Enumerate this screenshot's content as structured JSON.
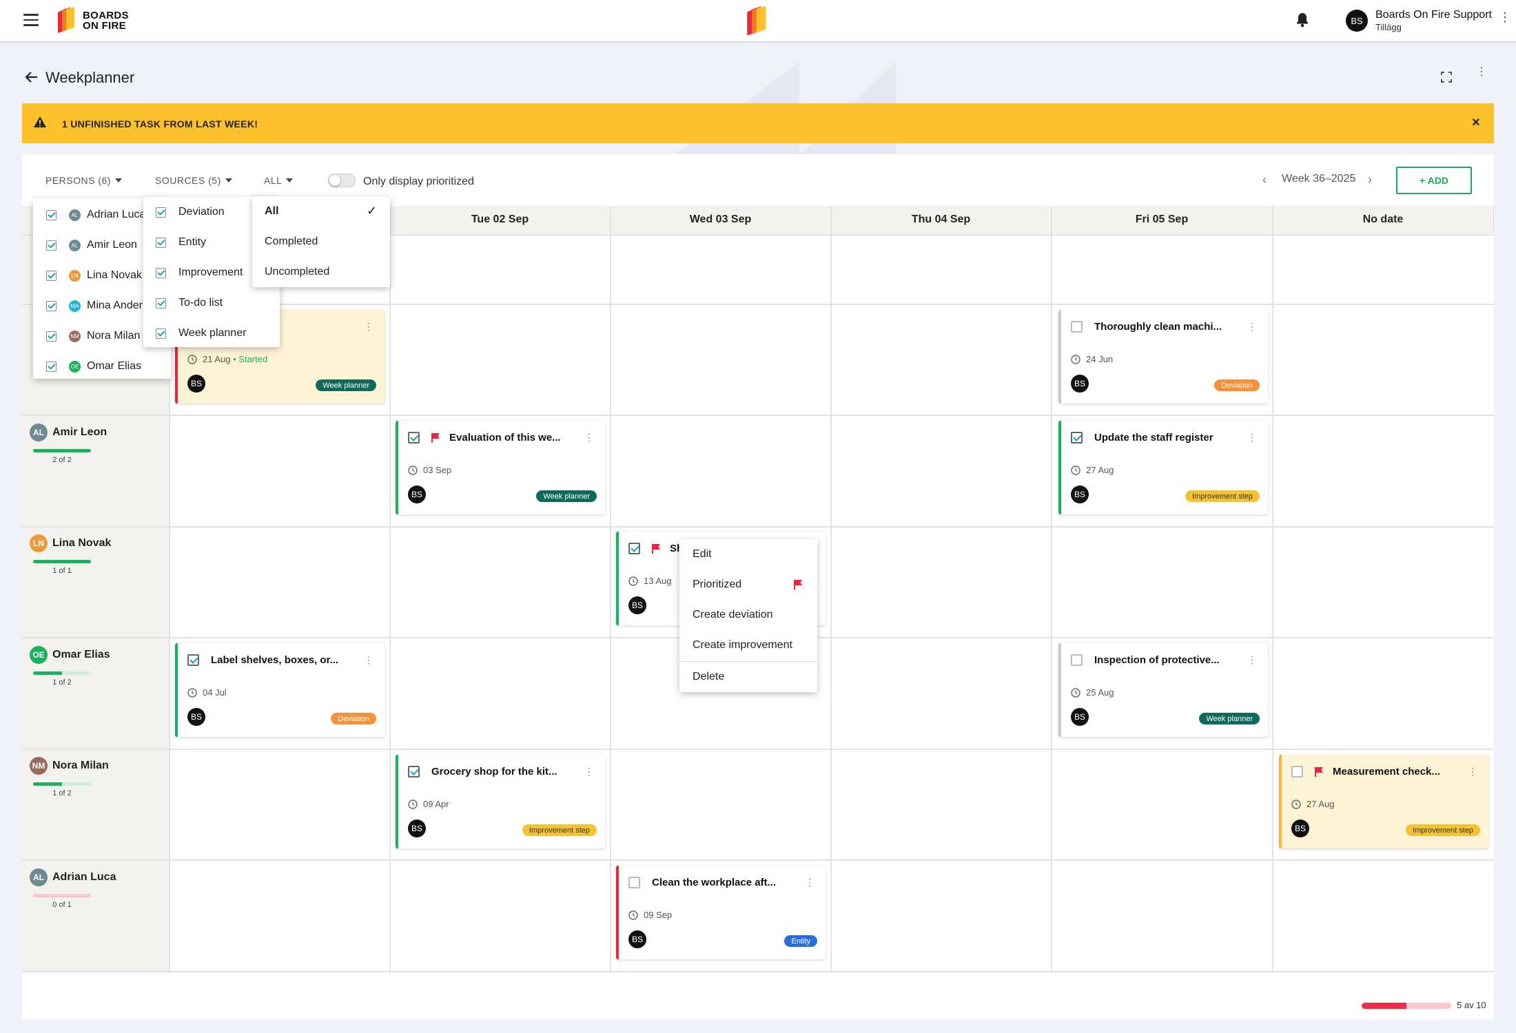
{
  "topbar": {
    "brand_line1": "BOARDS",
    "brand_line2": "ON FIRE",
    "user_initials": "BS",
    "user_name": "Boards On Fire Support",
    "user_sub": "Tillägg"
  },
  "page": {
    "title": "Weekplanner"
  },
  "banner": {
    "text": "1 UNFINISHED TASK FROM LAST WEEK!",
    "close": "×"
  },
  "toolbar": {
    "persons": "PERSONS (6)",
    "sources": "SOURCES (5)",
    "all": "ALL",
    "toggle_label": "Only display prioritized",
    "week": "Week 36–2025",
    "add": "+ ADD"
  },
  "columns": [
    "Tue 02 Sep",
    "Wed 03 Sep",
    "Thu 04 Sep",
    "Fri 05 Sep",
    "No date"
  ],
  "persons": [
    {
      "initials": "AL",
      "name": "Amir Leon",
      "count": "2 of 2",
      "progress": 1.0,
      "color": "#6b8a94"
    },
    {
      "initials": "LN",
      "name": "Lina Novak",
      "count": "1 of 1",
      "progress": 1.0,
      "color": "#e99a3a"
    },
    {
      "initials": "OE",
      "name": "Omar Elias",
      "count": "1 of 2",
      "progress": 0.5,
      "color": "#17b25a"
    },
    {
      "initials": "NM",
      "name": "Nora Milan",
      "count": "1 of 2",
      "progress": 0.5,
      "color": "#9a6a5e"
    },
    {
      "initials": "AL",
      "name": "Adrian Luca",
      "count": "0 of 1",
      "progress": 0.0,
      "color": "#6b8a94"
    }
  ],
  "cards": [
    {
      "title": "",
      "date": "21 Aug",
      "status": "• Started",
      "tag": "Week planner",
      "avatar": "BS"
    },
    {
      "title": "Thoroughly clean machi...",
      "date": "24 Jun",
      "tag": "Deviation",
      "avatar": "BS"
    },
    {
      "title": "Evaluation of this we...",
      "date": "03 Sep",
      "tag": "Week planner",
      "avatar": "BS"
    },
    {
      "title": "Update the staff register",
      "date": "27 Aug",
      "tag": "Improvement step",
      "avatar": "BS"
    },
    {
      "title": "Sh",
      "date": "13 Aug",
      "avatar": "BS"
    },
    {
      "title": "Label shelves, boxes, or...",
      "date": "04 Jul",
      "tag": "Deviation",
      "avatar": "BS"
    },
    {
      "title": "Inspection of protective...",
      "date": "25 Aug",
      "tag": "Week planner",
      "avatar": "BS"
    },
    {
      "title": "Grocery shop for the kit...",
      "date": "09 Apr",
      "tag": "Improvement step",
      "avatar": "BS"
    },
    {
      "title": "Measurement check...",
      "date": "27 Aug",
      "tag": "Improvement step",
      "avatar": "BS"
    },
    {
      "title": "Clean the workplace aft...",
      "date": "09 Sep",
      "tag": "Entity",
      "avatar": "BS"
    }
  ],
  "persons_dropdown": [
    {
      "initials": "AL",
      "name": "Adrian Luca",
      "color": "#6b8a94"
    },
    {
      "initials": "AL",
      "name": "Amir Leon",
      "color": "#6b8a94"
    },
    {
      "initials": "LN",
      "name": "Lina Novak",
      "color": "#e99a3a"
    },
    {
      "initials": "MA",
      "name": "Mina Ander",
      "color": "#20b3d8"
    },
    {
      "initials": "NM",
      "name": "Nora Milan",
      "color": "#9a6a5e"
    },
    {
      "initials": "OE",
      "name": "Omar Elias",
      "color": "#17b25a"
    }
  ],
  "sources_dropdown": [
    "Deviation",
    "Entity",
    "Improvement",
    "To-do list",
    "Week planner"
  ],
  "all_dropdown": [
    "All",
    "Completed",
    "Uncompleted"
  ],
  "context_menu": [
    "Edit",
    "Prioritized",
    "Create deviation",
    "Create improvement",
    "Delete"
  ],
  "pager": {
    "text": "5 av 10",
    "progress": 0.5
  }
}
